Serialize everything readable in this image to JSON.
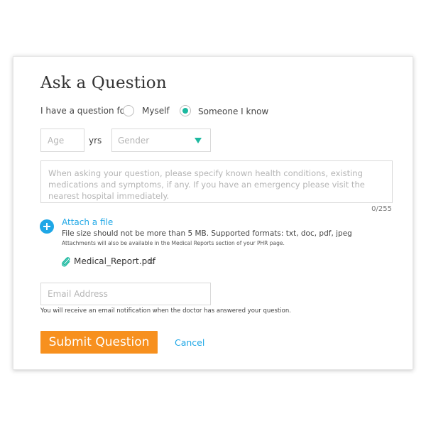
{
  "form": {
    "title": "Ask a Question",
    "question_for_label": "I have a question for",
    "options": [
      {
        "label": "Myself",
        "selected": false
      },
      {
        "label": "Someone I know",
        "selected": true
      }
    ],
    "age_placeholder": "Age",
    "age_unit": "yrs",
    "gender_placeholder": "Gender",
    "question_placeholder": "When asking your question, please specify known health conditions, existing medications and symptoms, if any. If you have an emergency please visit the nearest hospital immediately.",
    "char_counter": "0/255",
    "attach_label": "Attach a file",
    "attach_hint": "File size should not be more than 5 MB. Supported formats: txt, doc, pdf, jpeg",
    "attach_note": "Attachments will also be available in the Medical Reports section of your PHR page.",
    "attachment": {
      "name": "Medical_Report.pdf",
      "remove_symbol": "×"
    },
    "email_placeholder": "Email Address",
    "email_note": "You will receive an email notification when the doctor has answered your question.",
    "submit_label": "Submit Question",
    "cancel_label": "Cancel"
  },
  "colors": {
    "accent_teal": "#1db9a0",
    "link_blue": "#1fa7e6",
    "submit_orange": "#f7901e"
  },
  "icons": {
    "attach": "plus-circle-icon",
    "attachment": "paperclip-icon",
    "remove": "close-icon",
    "dropdown": "caret-down-icon"
  }
}
